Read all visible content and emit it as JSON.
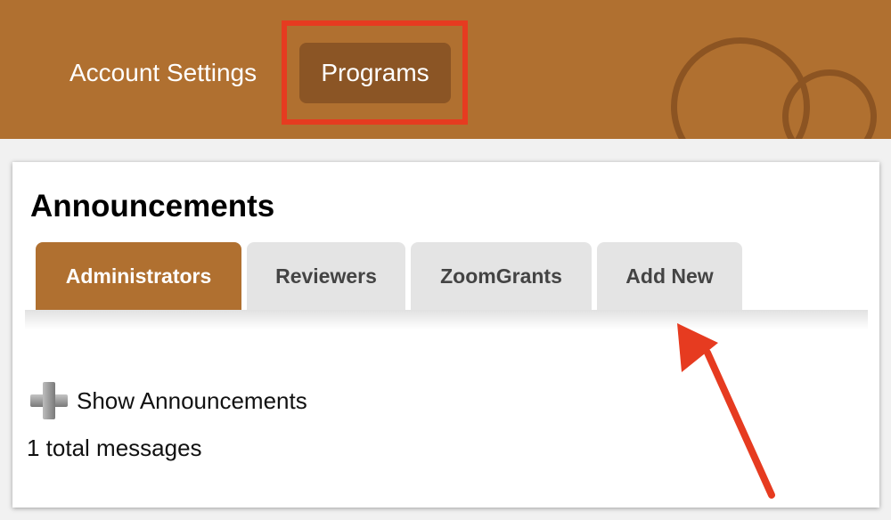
{
  "header": {
    "nav": {
      "account_settings": "Account Settings",
      "programs": "Programs"
    },
    "brand_color": "#b07030",
    "active_nav_color": "#8b5525"
  },
  "annotation": {
    "highlight_color": "#e63b20",
    "highlighted_item": "Programs",
    "arrow_target": "Add New"
  },
  "announcements": {
    "title": "Announcements",
    "tabs": [
      {
        "label": "Administrators",
        "active": true
      },
      {
        "label": "Reviewers",
        "active": false
      },
      {
        "label": "ZoomGrants",
        "active": false
      },
      {
        "label": "Add New",
        "active": false
      }
    ],
    "show_label": "Show Announcements",
    "show_icon": "plus-icon",
    "total_messages": "1 total messages"
  }
}
